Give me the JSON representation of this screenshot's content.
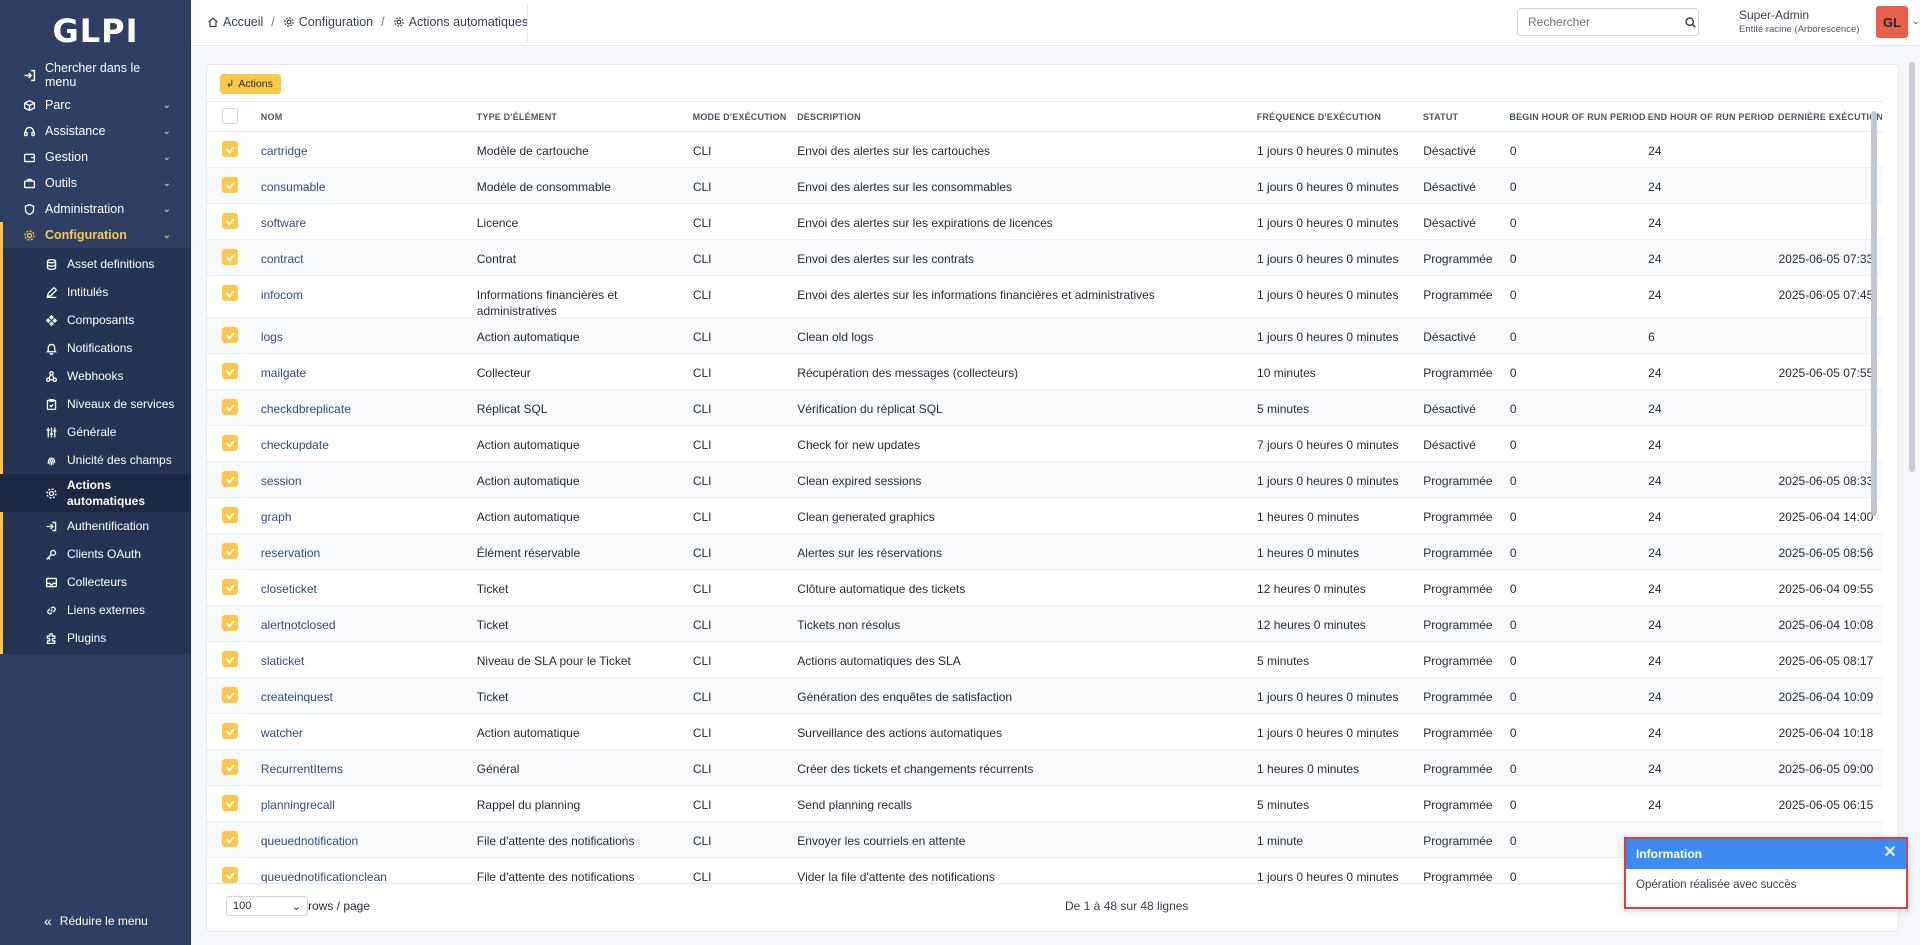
{
  "app": {
    "logo": "GLPI"
  },
  "sidebar": {
    "search_label": "Chercher dans le menu",
    "items": [
      {
        "label": "Parc"
      },
      {
        "label": "Assistance"
      },
      {
        "label": "Gestion"
      },
      {
        "label": "Outils"
      },
      {
        "label": "Administration"
      },
      {
        "label": "Configuration"
      }
    ],
    "subitems": [
      {
        "label": "Asset definitions"
      },
      {
        "label": "Intitulés"
      },
      {
        "label": "Composants"
      },
      {
        "label": "Notifications"
      },
      {
        "label": "Webhooks"
      },
      {
        "label": "Niveaux de services"
      },
      {
        "label": "Générale"
      },
      {
        "label": "Unicité des champs"
      },
      {
        "label": "Actions automatiques"
      },
      {
        "label": "Authentification"
      },
      {
        "label": "Clients OAuth"
      },
      {
        "label": "Collecteurs"
      },
      {
        "label": "Liens externes"
      },
      {
        "label": "Plugins"
      }
    ],
    "collapse_label": "Réduire le menu"
  },
  "breadcrumb": [
    "Accueil",
    "Configuration",
    "Actions automatiques"
  ],
  "search": {
    "placeholder": "Rechercher"
  },
  "user": {
    "name": "Super-Admin",
    "entity": "Entité racine (Arborescence)",
    "initials": "GL"
  },
  "toolbar": {
    "actions_label": "Actions"
  },
  "table": {
    "headers": [
      "Nom",
      "Type d'élément",
      "Mode d'exécution",
      "Description",
      "Fréquence d'exécution",
      "Statut",
      "Begin hour of run period",
      "End hour of run period",
      "Dernière exécution"
    ],
    "rows": [
      {
        "name": "cartridge",
        "type": "Modèle de cartouche",
        "mode": "CLI",
        "desc": "Envoi des alertes sur les cartouches",
        "freq": "1 jours 0 heures 0 minutes",
        "status": "Désactivé",
        "begin": "0",
        "end": "24",
        "last": ""
      },
      {
        "name": "consumable",
        "type": "Modèle de consommable",
        "mode": "CLI",
        "desc": "Envoi des alertes sur les consommables",
        "freq": "1 jours 0 heures 0 minutes",
        "status": "Désactivé",
        "begin": "0",
        "end": "24",
        "last": ""
      },
      {
        "name": "software",
        "type": "Licence",
        "mode": "CLI",
        "desc": "Envoi des alertes sur les expirations de licences",
        "freq": "1 jours 0 heures 0 minutes",
        "status": "Désactivé",
        "begin": "0",
        "end": "24",
        "last": ""
      },
      {
        "name": "contract",
        "type": "Contrat",
        "mode": "CLI",
        "desc": "Envoi des alertes sur les contrats",
        "freq": "1 jours 0 heures 0 minutes",
        "status": "Programmée",
        "begin": "0",
        "end": "24",
        "last": "2025-06-05 07:33"
      },
      {
        "name": "infocom",
        "type": "Informations financières et administratives",
        "mode": "CLI",
        "desc": "Envoi des alertes sur les informations financières et administratives",
        "freq": "1 jours 0 heures 0 minutes",
        "status": "Programmée",
        "begin": "0",
        "end": "24",
        "last": "2025-06-05 07:45"
      },
      {
        "name": "logs",
        "type": "Action automatique",
        "mode": "CLI",
        "desc": "Clean old logs",
        "freq": "1 jours 0 heures 0 minutes",
        "status": "Désactivé",
        "begin": "0",
        "end": "6",
        "last": ""
      },
      {
        "name": "mailgate",
        "type": "Collecteur",
        "mode": "CLI",
        "desc": "Récupération des messages (collecteurs)",
        "freq": "10 minutes",
        "status": "Programmée",
        "begin": "0",
        "end": "24",
        "last": "2025-06-05 07:55"
      },
      {
        "name": "checkdbreplicate",
        "type": "Réplicat SQL",
        "mode": "CLI",
        "desc": "Vérification du réplicat SQL",
        "freq": "5 minutes",
        "status": "Désactivé",
        "begin": "0",
        "end": "24",
        "last": ""
      },
      {
        "name": "checkupdate",
        "type": "Action automatique",
        "mode": "CLI",
        "desc": "Check for new updates",
        "freq": "7 jours 0 heures 0 minutes",
        "status": "Désactivé",
        "begin": "0",
        "end": "24",
        "last": ""
      },
      {
        "name": "session",
        "type": "Action automatique",
        "mode": "CLI",
        "desc": "Clean expired sessions",
        "freq": "1 jours 0 heures 0 minutes",
        "status": "Programmée",
        "begin": "0",
        "end": "24",
        "last": "2025-06-05 08:33"
      },
      {
        "name": "graph",
        "type": "Action automatique",
        "mode": "CLI",
        "desc": "Clean generated graphics",
        "freq": "1 heures 0 minutes",
        "status": "Programmée",
        "begin": "0",
        "end": "24",
        "last": "2025-06-04 14:00"
      },
      {
        "name": "reservation",
        "type": "Élément réservable",
        "mode": "CLI",
        "desc": "Alertes sur les réservations",
        "freq": "1 heures 0 minutes",
        "status": "Programmée",
        "begin": "0",
        "end": "24",
        "last": "2025-06-05 08:56"
      },
      {
        "name": "closeticket",
        "type": "Ticket",
        "mode": "CLI",
        "desc": "Clôture automatique des tickets",
        "freq": "12 heures 0 minutes",
        "status": "Programmée",
        "begin": "0",
        "end": "24",
        "last": "2025-06-04 09:55"
      },
      {
        "name": "alertnotclosed",
        "type": "Ticket",
        "mode": "CLI",
        "desc": "Tickets non résolus",
        "freq": "12 heures 0 minutes",
        "status": "Programmée",
        "begin": "0",
        "end": "24",
        "last": "2025-06-04 10:08"
      },
      {
        "name": "slaticket",
        "type": "Niveau de SLA pour le Ticket",
        "mode": "CLI",
        "desc": "Actions automatiques des SLA",
        "freq": "5 minutes",
        "status": "Programmée",
        "begin": "0",
        "end": "24",
        "last": "2025-06-05 08:17"
      },
      {
        "name": "createinquest",
        "type": "Ticket",
        "mode": "CLI",
        "desc": "Génération des enquêtes de satisfaction",
        "freq": "1 jours 0 heures 0 minutes",
        "status": "Programmée",
        "begin": "0",
        "end": "24",
        "last": "2025-06-04 10:09"
      },
      {
        "name": "watcher",
        "type": "Action automatique",
        "mode": "CLI",
        "desc": "Surveillance des actions automatiques",
        "freq": "1 jours 0 heures 0 minutes",
        "status": "Programmée",
        "begin": "0",
        "end": "24",
        "last": "2025-06-04 10:18"
      },
      {
        "name": "RecurrentItems",
        "type": "Général",
        "mode": "CLI",
        "desc": "Créer des tickets et changements récurrents",
        "freq": "1 heures 0 minutes",
        "status": "Programmée",
        "begin": "0",
        "end": "24",
        "last": "2025-06-05 09:00"
      },
      {
        "name": "planningrecall",
        "type": "Rappel du planning",
        "mode": "CLI",
        "desc": "Send planning recalls",
        "freq": "5 minutes",
        "status": "Programmée",
        "begin": "0",
        "end": "24",
        "last": "2025-06-05 06:15"
      },
      {
        "name": "queuednotification",
        "type": "File d'attente des notifications",
        "mode": "CLI",
        "desc": "Envoyer les courriels en attente",
        "freq": "1 minute",
        "status": "Programmée",
        "begin": "0",
        "end": "",
        "last": ""
      },
      {
        "name": "queuednotificationclean",
        "type": "File d'attente des notifications",
        "mode": "CLI",
        "desc": "Vider la file d'attente des notifications",
        "freq": "1 jours 0 heures 0 minutes",
        "status": "Programmée",
        "begin": "0",
        "end": "",
        "last": ""
      }
    ]
  },
  "footer": {
    "rows_value": "100",
    "rows_label": "rows / page",
    "pager_info": "De 1 à 48 sur 48 lignes"
  },
  "toast": {
    "title": "Information",
    "message": "Opération réalisée avec succès"
  },
  "colors": {
    "sidebar_bg": "#2f3f64",
    "accent": "#fcc84a",
    "toast_header": "#3d8bf0",
    "highlight_border": "#e03e3e"
  }
}
